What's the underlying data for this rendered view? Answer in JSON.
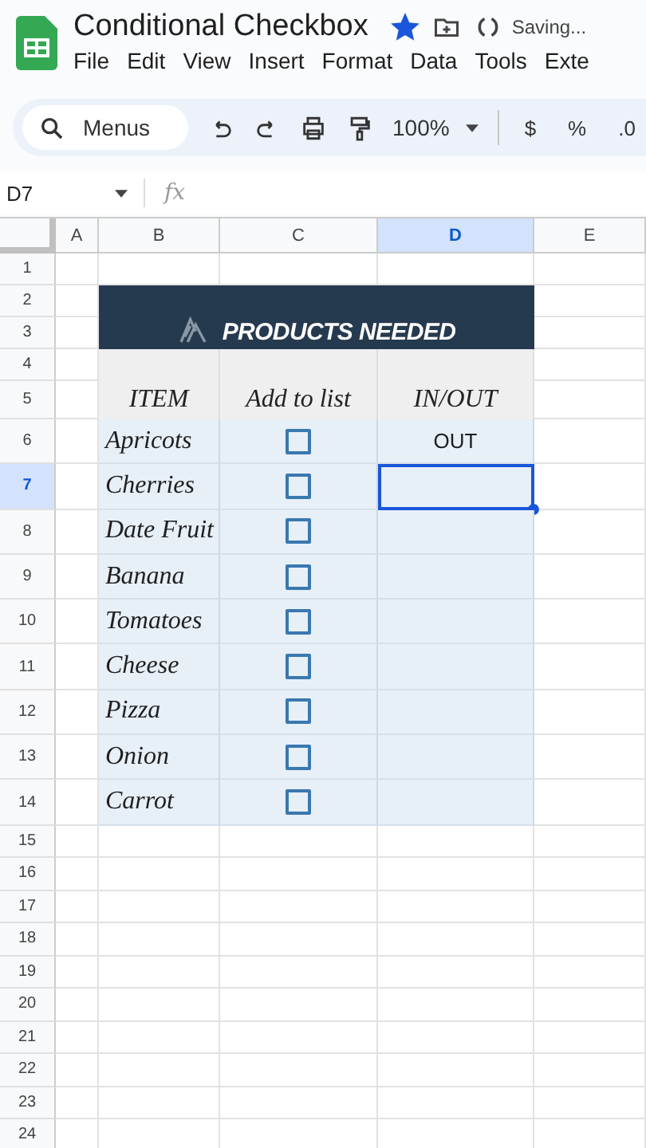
{
  "document": {
    "title": "Conditional Checkbox",
    "starred": true,
    "status": "Saving..."
  },
  "menus": [
    "File",
    "Edit",
    "View",
    "Insert",
    "Format",
    "Data",
    "Tools",
    "Exte"
  ],
  "toolbar": {
    "search": {
      "placeholder": "Menus"
    },
    "zoom": "100%",
    "format_buttons": [
      "$",
      "%",
      ".0"
    ]
  },
  "formula_bar": {
    "cell": "D7",
    "fx": "fx"
  },
  "columns": [
    {
      "label": "A",
      "selected": false
    },
    {
      "label": "B",
      "selected": false
    },
    {
      "label": "C",
      "selected": false
    },
    {
      "label": "D",
      "selected": true
    },
    {
      "label": "E",
      "selected": false
    }
  ],
  "rows": [
    {
      "label": "1",
      "selected": false
    },
    {
      "label": "2",
      "selected": false
    },
    {
      "label": "3",
      "selected": false
    },
    {
      "label": "4",
      "selected": false
    },
    {
      "label": "5",
      "selected": false
    },
    {
      "label": "6",
      "selected": false
    },
    {
      "label": "7",
      "selected": true
    },
    {
      "label": "8",
      "selected": false
    },
    {
      "label": "9",
      "selected": false
    },
    {
      "label": "10",
      "selected": false
    },
    {
      "label": "11",
      "selected": false
    },
    {
      "label": "12",
      "selected": false
    },
    {
      "label": "13",
      "selected": false
    },
    {
      "label": "14",
      "selected": false
    },
    {
      "label": "15",
      "selected": false
    },
    {
      "label": "16",
      "selected": false
    },
    {
      "label": "17",
      "selected": false
    },
    {
      "label": "18",
      "selected": false
    },
    {
      "label": "19",
      "selected": false
    },
    {
      "label": "20",
      "selected": false
    },
    {
      "label": "21",
      "selected": false
    },
    {
      "label": "22",
      "selected": false
    },
    {
      "label": "23",
      "selected": false
    },
    {
      "label": "24",
      "selected": false
    }
  ],
  "banner": {
    "title": "PRODUCTS NEEDED"
  },
  "headers": [
    "ITEM",
    "Add to list",
    "IN/OUT"
  ],
  "items": [
    {
      "name": "Apricots",
      "checked": false,
      "in_out": "OUT",
      "selected": false
    },
    {
      "name": "Cherries",
      "checked": false,
      "selected": true
    },
    {
      "name": "Date Fruit",
      "checked": false,
      "selected": false
    },
    {
      "name": "Banana",
      "checked": false,
      "selected": false
    },
    {
      "name": "Tomatoes",
      "checked": false,
      "selected": false
    },
    {
      "name": "Cheese",
      "checked": false,
      "selected": false
    },
    {
      "name": "Pizza",
      "checked": false,
      "selected": false
    },
    {
      "name": "Onion",
      "checked": false,
      "selected": false
    },
    {
      "name": "Carrot",
      "checked": false,
      "selected": false
    }
  ]
}
